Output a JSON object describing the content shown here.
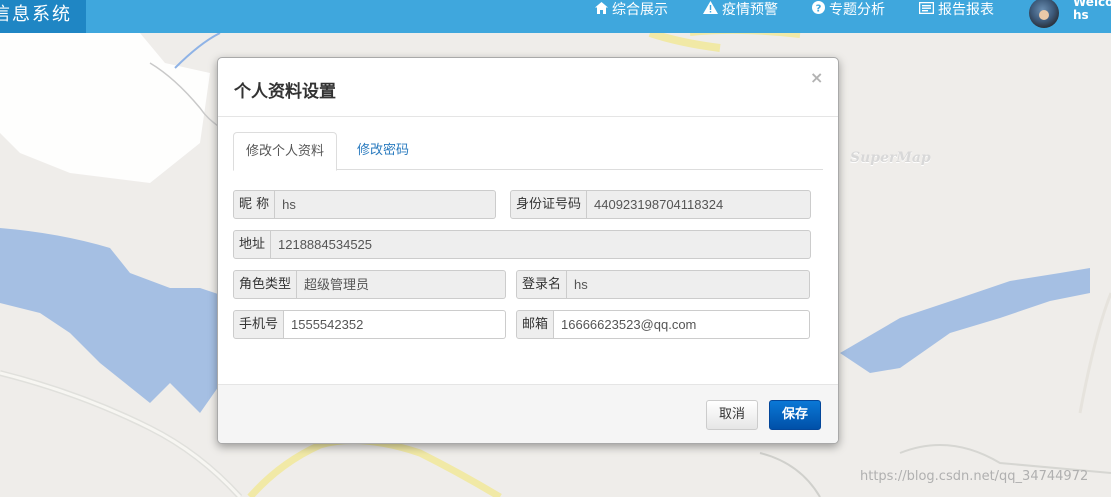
{
  "app": {
    "brand": "信息系统",
    "nav": [
      {
        "label": "综合展示",
        "icon": "home-icon"
      },
      {
        "label": "疫情预警",
        "icon": "warning-icon"
      },
      {
        "label": "专题分析",
        "icon": "question-circle-icon"
      },
      {
        "label": "报告报表",
        "icon": "report-icon"
      }
    ],
    "welcome": "Welcome",
    "user": "hs"
  },
  "map": {
    "watermark": "https://blog.csdn.net/qq_34744972",
    "supermap": "SuperMap"
  },
  "modal": {
    "title": "个人资料设置",
    "close": "×",
    "tabs": [
      "修改个人资料",
      "修改密码"
    ],
    "fields": {
      "nickname": {
        "label": "昵 称",
        "value": "hs"
      },
      "id_number": {
        "label": "身份证号码",
        "value": "440923198704118324"
      },
      "address": {
        "label": "地址",
        "value": "1218884534525"
      },
      "role": {
        "label": "角色类型",
        "value": "超级管理员"
      },
      "login": {
        "label": "登录名",
        "value": "hs"
      },
      "phone": {
        "label": "手机号",
        "value": "1555542352"
      },
      "email": {
        "label": "邮箱",
        "value": "16666623523@qq.com"
      }
    },
    "buttons": {
      "cancel": "取消",
      "save": "保存"
    }
  },
  "colors": {
    "topbar": "#3fa7dd",
    "brand_bg": "#1f86c4",
    "water": "#a5bfe3",
    "primary": "#0a6cc8"
  }
}
